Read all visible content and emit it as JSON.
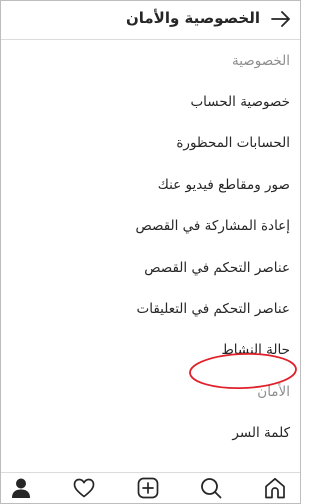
{
  "header": {
    "title": "الخصوصية والأمان",
    "back_icon": "arrow-right-icon"
  },
  "menu": {
    "items": [
      {
        "label": "الخصوصية",
        "kind": "section"
      },
      {
        "label": "خصوصية الحساب",
        "kind": "link"
      },
      {
        "label": "الحسابات المحظورة",
        "kind": "link"
      },
      {
        "label": "صور ومقاطع فيديو عنك",
        "kind": "link"
      },
      {
        "label": "إعادة المشاركة في القصص",
        "kind": "link"
      },
      {
        "label": "عناصر التحكم في القصص",
        "kind": "link"
      },
      {
        "label": "عناصر التحكم في التعليقات",
        "kind": "link"
      },
      {
        "label": "حالة النشاط",
        "kind": "link",
        "highlighted": true
      },
      {
        "label": "الأمان",
        "kind": "section"
      },
      {
        "label": "كلمة السر",
        "kind": "link"
      }
    ]
  },
  "annotation": {
    "shape": "ellipse",
    "color": "#e0202a",
    "target": "حالة النشاط"
  },
  "tabbar": {
    "tabs": [
      {
        "icon": "profile-icon",
        "active": true
      },
      {
        "icon": "heart-icon"
      },
      {
        "icon": "add-post-icon"
      },
      {
        "icon": "search-icon"
      },
      {
        "icon": "home-icon"
      }
    ]
  },
  "colors": {
    "text": "#262626",
    "section_text": "#8e8e8e",
    "divider": "#dbdbdb",
    "annotation": "#e0202a"
  }
}
